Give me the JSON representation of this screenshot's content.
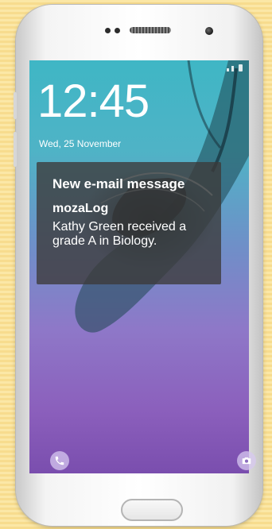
{
  "lock_screen": {
    "time": "12:45",
    "date": "Wed, 25 November"
  },
  "notification": {
    "title": "New e-mail message",
    "app": "mozaLog",
    "body": "Kathy Green received a grade A in Biology."
  },
  "shortcuts": {
    "left_icon": "phone-icon",
    "right_icon": "camera-icon"
  },
  "colors": {
    "background": "#fbe7a6",
    "screen_top": "#3fb6c5",
    "screen_bottom": "#7a4eae",
    "notification_bg": "#3c3a38"
  }
}
